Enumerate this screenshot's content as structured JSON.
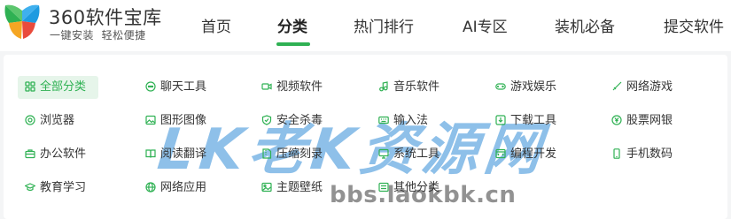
{
  "brand": {
    "title": "360软件宝库",
    "subtitle": "一键安装  轻松便捷"
  },
  "nav": {
    "items": [
      "首页",
      "分类",
      "热门排行",
      "AI专区",
      "装机必备",
      "提交软件"
    ],
    "active": "分类"
  },
  "categories": [
    {
      "label": "全部分类",
      "icon": "grid-icon",
      "active": true
    },
    {
      "label": "聊天工具",
      "icon": "chat-icon"
    },
    {
      "label": "视频软件",
      "icon": "video-icon"
    },
    {
      "label": "音乐软件",
      "icon": "music-icon"
    },
    {
      "label": "游戏娱乐",
      "icon": "gamepad-icon"
    },
    {
      "label": "网络游戏",
      "icon": "sword-icon"
    },
    {
      "label": "浏览器",
      "icon": "browser-icon"
    },
    {
      "label": "图形图像",
      "icon": "image-icon"
    },
    {
      "label": "安全杀毒",
      "icon": "shield-icon"
    },
    {
      "label": "输入法",
      "icon": "keyboard-icon"
    },
    {
      "label": "下载工具",
      "icon": "download-icon"
    },
    {
      "label": "股票网银",
      "icon": "yen-coin-icon"
    },
    {
      "label": "办公软件",
      "icon": "briefcase-icon"
    },
    {
      "label": "阅读翻译",
      "icon": "book-icon"
    },
    {
      "label": "压缩刻录",
      "icon": "archive-icon"
    },
    {
      "label": "系统工具",
      "icon": "system-icon"
    },
    {
      "label": "编程开发",
      "icon": "code-icon"
    },
    {
      "label": "手机数码",
      "icon": "phone-icon"
    },
    {
      "label": "教育学习",
      "icon": "graduation-cap-icon"
    },
    {
      "label": "网络应用",
      "icon": "globe-icon"
    },
    {
      "label": "主题壁纸",
      "icon": "wallpaper-icon"
    },
    {
      "label": "其他分类",
      "icon": "list-icon"
    }
  ],
  "watermark": {
    "logo_text": "LK老K资源网",
    "url": "bbs.laokbk.cn"
  },
  "colors": {
    "accent": "#2fb153",
    "active_bg": "#e6f5ea",
    "watermark": "#328cd7"
  }
}
